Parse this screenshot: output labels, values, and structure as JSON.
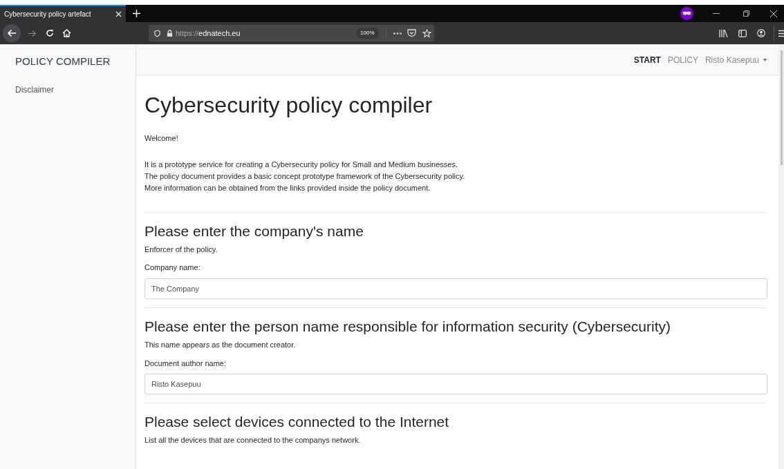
{
  "browser": {
    "tab": {
      "title": "Cybersecurity policy artefact",
      "selected": true
    },
    "url_scheme": "https://",
    "url_host": "ednatech.eu",
    "zoom": "100%"
  },
  "sidebar": {
    "brand": "POLICY COMPILER",
    "items": [
      "Disclaimer"
    ]
  },
  "navbar": {
    "items": [
      {
        "label": "START",
        "selected": true
      },
      {
        "label": "POLICY",
        "selected": false
      }
    ],
    "user": "Risto Kasepuu"
  },
  "page": {
    "title": "Cybersecurity policy compiler",
    "welcome": "Welcome!",
    "intro": [
      "It is a prototype service for creating a Cybersecurity policy for Small and Medium businesses.",
      "The policy document provides a basic concept prototype framework of the Cybersecurity policy.",
      "More information can be obtained from the links provided inside the policy document."
    ],
    "sections": [
      {
        "heading": "Please enter the company's name",
        "description": "Enforcer of the policy.",
        "label": "Company name:",
        "value": "The Company"
      },
      {
        "heading": "Please enter the person name responsible for information security (Cybersecurity)",
        "description": "This name appears as the document creator.",
        "label": "Document author name:",
        "value": "Risto Kasepuu"
      },
      {
        "heading": "Please select devices connected to the Internet",
        "description": "List all the devices that are connected to the companys network."
      }
    ]
  }
}
